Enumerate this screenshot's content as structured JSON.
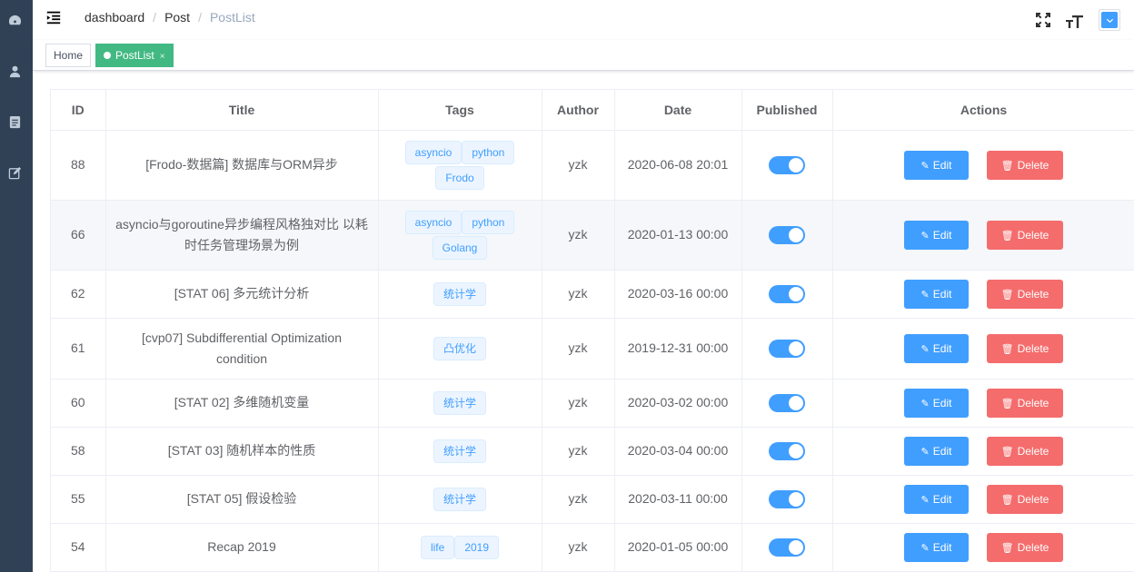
{
  "sidebar": {
    "icons": [
      "dashboard-icon",
      "user-icon",
      "document-icon",
      "edit-icon"
    ]
  },
  "navbar": {
    "breadcrumb": [
      "dashboard",
      "Post",
      "PostList"
    ],
    "actions": [
      "fullscreen-icon",
      "font-size-icon",
      "avatar-dropdown"
    ]
  },
  "tags_view": [
    {
      "label": "Home",
      "active": false
    },
    {
      "label": "PostList",
      "active": true,
      "close": "×"
    }
  ],
  "table": {
    "columns": [
      "ID",
      "Title",
      "Tags",
      "Author",
      "Date",
      "Published",
      "Actions"
    ],
    "rows": [
      {
        "id": "88",
        "title": "[Frodo-数据篇] 数据库与ORM异步",
        "tags": [
          "asyncio",
          "python",
          "Frodo"
        ],
        "author": "yzk",
        "date": "2020-06-08 20:01",
        "published": true
      },
      {
        "id": "66",
        "title": "asyncio与goroutine异步编程风格独对比 以耗时任务管理场景为例",
        "tags": [
          "asyncio",
          "python",
          "Golang"
        ],
        "author": "yzk",
        "date": "2020-01-13 00:00",
        "published": true
      },
      {
        "id": "62",
        "title": "[STAT 06] 多元统计分析",
        "tags": [
          "统计学"
        ],
        "author": "yzk",
        "date": "2020-03-16 00:00",
        "published": true
      },
      {
        "id": "61",
        "title": "[cvp07] Subdifferential Optimization condition",
        "tags": [
          "凸优化"
        ],
        "author": "yzk",
        "date": "2019-12-31 00:00",
        "published": true
      },
      {
        "id": "60",
        "title": "[STAT 02] 多维随机变量",
        "tags": [
          "统计学"
        ],
        "author": "yzk",
        "date": "2020-03-02 00:00",
        "published": true
      },
      {
        "id": "58",
        "title": "[STAT 03] 随机样本的性质",
        "tags": [
          "统计学"
        ],
        "author": "yzk",
        "date": "2020-03-04 00:00",
        "published": true
      },
      {
        "id": "55",
        "title": "[STAT 05] 假设检验",
        "tags": [
          "统计学"
        ],
        "author": "yzk",
        "date": "2020-03-11 00:00",
        "published": true
      },
      {
        "id": "54",
        "title": "Recap 2019",
        "tags": [
          "life",
          "2019"
        ],
        "author": "yzk",
        "date": "2020-01-05 00:00",
        "published": true
      }
    ],
    "edit_label": "Edit",
    "delete_label": "Delete"
  },
  "colors": {
    "sidebar_bg": "#304156",
    "primary": "#409eff",
    "danger": "#f56c6c",
    "active_tag": "#42b983"
  }
}
